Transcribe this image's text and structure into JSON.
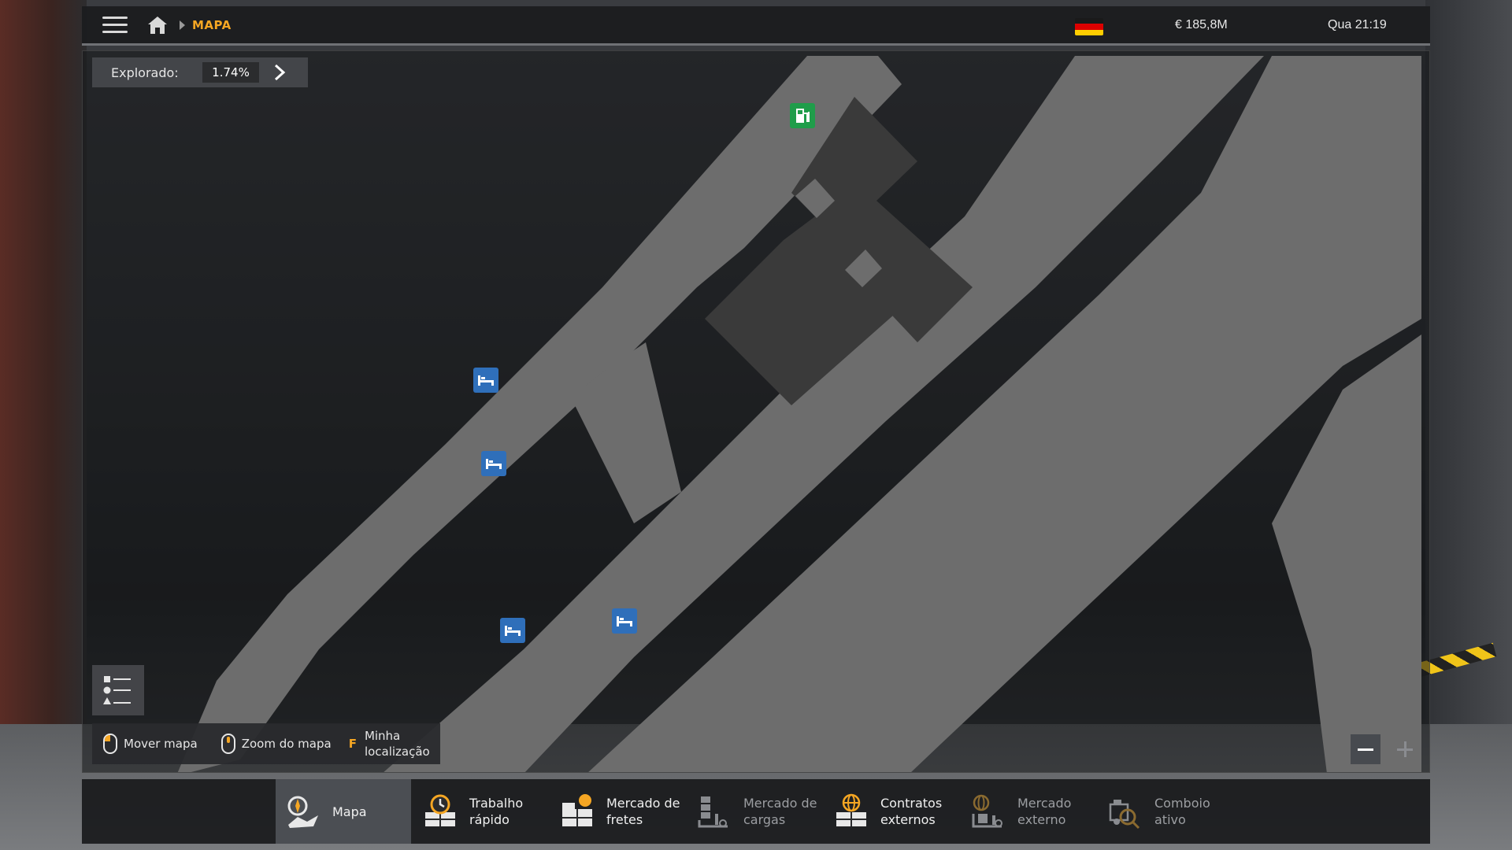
{
  "topbar": {
    "breadcrumb": "MAPA",
    "flag_colors": [
      "#1a1a1a",
      "#dd0000",
      "#ffce00"
    ],
    "money": "€ 185,8M",
    "clock": "Qua 21:19",
    "icons": {
      "menu": "hamburger-menu-icon",
      "home": "home-icon"
    }
  },
  "map": {
    "explored_label": "Explorado:",
    "explored_value": "1.74%",
    "colors": {
      "road": "#6d6d6d",
      "building": "#3a3a3a",
      "bed_poi": "#2f6fba",
      "fuel_poi": "#1f9d4a"
    },
    "pois": [
      {
        "type": "fuel",
        "icon": "fuel-station-icon"
      },
      {
        "type": "bed",
        "icon": "bed-icon"
      },
      {
        "type": "bed",
        "icon": "bed-icon"
      },
      {
        "type": "bed",
        "icon": "bed-icon"
      },
      {
        "type": "bed",
        "icon": "bed-icon"
      }
    ],
    "hints": {
      "move": "Mover mapa",
      "zoom": "Zoom do mapa",
      "locate_key": "F",
      "locate_line1": "Minha",
      "locate_line2": "localização"
    }
  },
  "nav": {
    "accent": "#f5a623",
    "items": [
      {
        "label": "Mapa",
        "active": true,
        "enabled": true
      },
      {
        "label": "Trabalho\nrápido",
        "active": false,
        "enabled": true
      },
      {
        "label": "Mercado de\nfretes",
        "active": false,
        "enabled": true
      },
      {
        "label": "Mercado de\ncargas",
        "active": false,
        "enabled": false
      },
      {
        "label": "Contratos\nexternos",
        "active": false,
        "enabled": true
      },
      {
        "label": "Mercado\nexterno",
        "active": false,
        "enabled": false
      },
      {
        "label": "Comboio\nativo",
        "active": false,
        "enabled": false
      }
    ]
  }
}
